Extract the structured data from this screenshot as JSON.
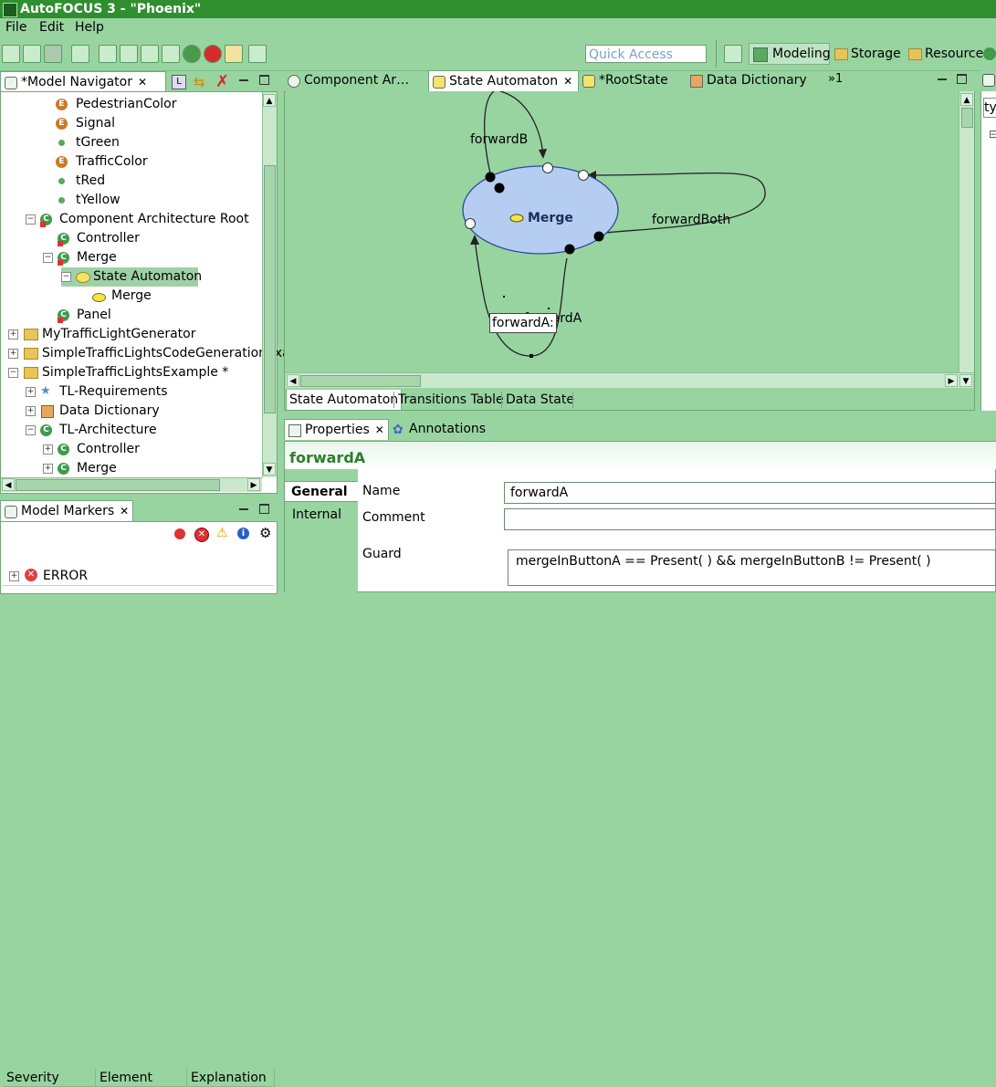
{
  "window": {
    "title": "AutoFOCUS 3 - \"Phoenix\""
  },
  "menu": {
    "file": "File",
    "edit": "Edit",
    "help": "Help"
  },
  "toolbar": {
    "quick_access_placeholder": "Quick Access",
    "perspectives": [
      "Modeling",
      "Storage",
      "Resource"
    ]
  },
  "navigator": {
    "title": "*Model Navigator",
    "items": [
      {
        "label": "PedestrianColor"
      },
      {
        "label": "Signal"
      },
      {
        "label": "tGreen"
      },
      {
        "label": "TrafficColor"
      },
      {
        "label": "tRed"
      },
      {
        "label": "tYellow"
      },
      {
        "label": "Component Architecture Root"
      },
      {
        "label": "Controller"
      },
      {
        "label": "Merge"
      },
      {
        "label": "State Automaton"
      },
      {
        "label": "Merge"
      },
      {
        "label": "Panel"
      },
      {
        "label": "MyTrafficLightGenerator"
      },
      {
        "label": "SimpleTrafficLightsCodeGenerationExa"
      },
      {
        "label": "SimpleTrafficLightsExample *"
      },
      {
        "label": "TL-Requirements"
      },
      {
        "label": "Data Dictionary"
      },
      {
        "label": "TL-Architecture"
      },
      {
        "label": "Controller"
      },
      {
        "label": "Merge"
      }
    ]
  },
  "markers": {
    "title": "Model Markers",
    "columns": [
      "Severity",
      "Element",
      "Explanation"
    ],
    "rows": [
      {
        "severity": "ERROR"
      }
    ]
  },
  "editor": {
    "tabs": [
      "Component Ar…",
      "State Automaton",
      "*RootState",
      "Data Dictionary"
    ],
    "overflow": "»1",
    "bottom_tabs": [
      "State Automaton",
      "Transitions Table",
      "Data State"
    ],
    "diagram": {
      "state_name": "Merge",
      "transitions": [
        "forwardB",
        "forwardBoth",
        "forwardA"
      ],
      "edit_label": "forwardA:"
    }
  },
  "properties": {
    "tabs": [
      "Properties",
      "Annotations"
    ],
    "heading": "forwardA",
    "sections": [
      "General",
      "Internal"
    ],
    "labels": {
      "name": "Name",
      "comment": "Comment",
      "guard": "Guard"
    },
    "values": {
      "name": "forwardA",
      "comment": "",
      "guard": "mergeInButtonA == Present( ) && mergeInButtonB != Present( )"
    }
  },
  "right_panel": {
    "fragment": "ty"
  },
  "colors": {
    "title_bar": "#2f8f2f",
    "workbench": "#98d4a0",
    "heading_green": "#2d7d2d",
    "state_fill": "#b5cdf0"
  }
}
